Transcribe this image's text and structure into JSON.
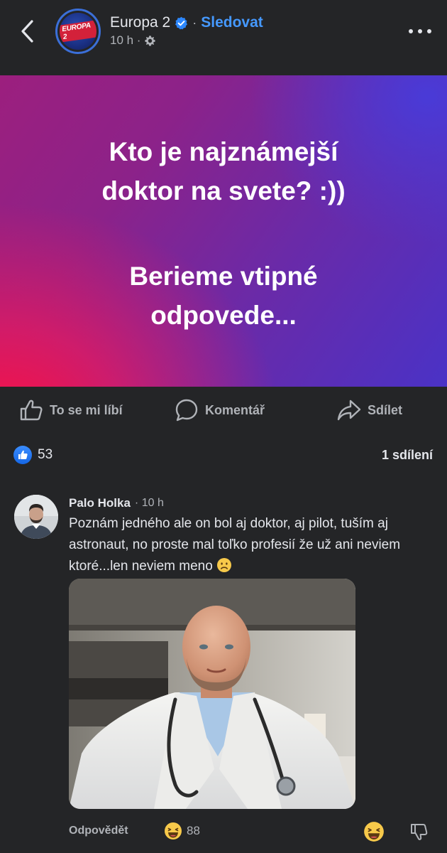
{
  "header": {
    "page_name": "Europa 2",
    "follow_label": "Sledovat",
    "separator": "·",
    "time": "10 h ·",
    "avatar_logo_text": "EUROPA 2"
  },
  "post": {
    "banner_line1": "Kto je najznámejší doktor na svete? :))",
    "banner_line2": "Berieme vtipné odpovede...",
    "colors": {
      "gradient_start": "#ff1040",
      "gradient_mid": "#8c2289",
      "gradient_end": "#4a32c6"
    }
  },
  "actions": {
    "like_label": "To se mi líbí",
    "comment_label": "Komentář",
    "share_label": "Sdílet"
  },
  "reactions": {
    "like_count": "53",
    "shares_label": "1 sdílení"
  },
  "comment": {
    "author": "Palo Holka",
    "time": "· 10 h",
    "text": "Poznám jedného ale on bol aj doktor, aj pilot, tuším aj astronaut, no proste mal toľko profesií že už ani neviem ktoré...len neviem meno",
    "reply_label": "Odpovědět",
    "reaction_count": "88",
    "reaction_icon": "laughing-emoji"
  },
  "colors": {
    "background": "#242527",
    "accent": "#4599ff",
    "text_primary": "#e4e6eb",
    "text_secondary": "#b0b3b8"
  }
}
